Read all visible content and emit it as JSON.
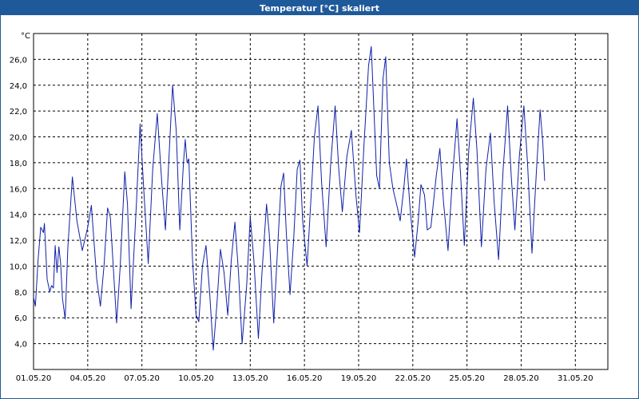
{
  "window": {
    "title": "Temperatur [°C] skaliert"
  },
  "chart_data": {
    "type": "line",
    "title": "Temperatur [°C] skaliert",
    "ylabel": "°C",
    "xlabel": "",
    "ylim": [
      2.0,
      28.0
    ],
    "xlim": [
      0,
      31.8
    ],
    "grid": true,
    "line_color": "#1020a8",
    "y_ticks": [
      {
        "value": 4,
        "label": "4,0"
      },
      {
        "value": 6,
        "label": "6,0"
      },
      {
        "value": 8,
        "label": "8,0"
      },
      {
        "value": 10,
        "label": "10,0"
      },
      {
        "value": 12,
        "label": "12,0"
      },
      {
        "value": 14,
        "label": "14,0"
      },
      {
        "value": 16,
        "label": "16,0"
      },
      {
        "value": 18,
        "label": "18,0"
      },
      {
        "value": 20,
        "label": "20,0"
      },
      {
        "value": 22,
        "label": "22,0"
      },
      {
        "value": 24,
        "label": "24,0"
      },
      {
        "value": 26,
        "label": "26,0"
      }
    ],
    "x_ticks": [
      {
        "value": 0,
        "label": "01.05.20"
      },
      {
        "value": 3,
        "label": "04.05.20"
      },
      {
        "value": 6,
        "label": "07.05.20"
      },
      {
        "value": 9,
        "label": "10.05.20"
      },
      {
        "value": 12,
        "label": "13.05.20"
      },
      {
        "value": 15,
        "label": "16.05.20"
      },
      {
        "value": 18,
        "label": "19.05.20"
      },
      {
        "value": 21,
        "label": "22.05.20"
      },
      {
        "value": 24,
        "label": "25.05.20"
      },
      {
        "value": 27,
        "label": "28.05.20"
      },
      {
        "value": 30,
        "label": "31.05.20"
      }
    ],
    "series": [
      {
        "points": [
          [
            0.0,
            7.6
          ],
          [
            0.1,
            6.9
          ],
          [
            0.25,
            10.5
          ],
          [
            0.4,
            13.0
          ],
          [
            0.55,
            12.6
          ],
          [
            0.6,
            13.3
          ],
          [
            0.75,
            9.0
          ],
          [
            0.9,
            8.0
          ],
          [
            1.0,
            8.5
          ],
          [
            1.1,
            8.3
          ],
          [
            1.2,
            11.6
          ],
          [
            1.3,
            9.5
          ],
          [
            1.4,
            11.5
          ],
          [
            1.5,
            10.2
          ],
          [
            1.6,
            7.5
          ],
          [
            1.75,
            5.9
          ],
          [
            1.9,
            11.5
          ],
          [
            2.15,
            16.9
          ],
          [
            2.4,
            13.5
          ],
          [
            2.7,
            11.2
          ],
          [
            3.0,
            13.0
          ],
          [
            3.2,
            14.7
          ],
          [
            3.5,
            9.0
          ],
          [
            3.7,
            6.9
          ],
          [
            3.9,
            10.0
          ],
          [
            4.1,
            14.5
          ],
          [
            4.25,
            13.8
          ],
          [
            4.6,
            5.6
          ],
          [
            4.8,
            10.0
          ],
          [
            5.05,
            17.3
          ],
          [
            5.2,
            14.8
          ],
          [
            5.4,
            6.7
          ],
          [
            5.7,
            15.0
          ],
          [
            5.9,
            21.0
          ],
          [
            6.1,
            16.0
          ],
          [
            6.35,
            10.2
          ],
          [
            6.6,
            17.5
          ],
          [
            6.85,
            21.8
          ],
          [
            7.1,
            16.5
          ],
          [
            7.3,
            12.8
          ],
          [
            7.5,
            18.5
          ],
          [
            7.7,
            24.0
          ],
          [
            7.9,
            20.5
          ],
          [
            8.1,
            12.8
          ],
          [
            8.3,
            18.0
          ],
          [
            8.4,
            19.8
          ],
          [
            8.5,
            18.0
          ],
          [
            8.6,
            18.3
          ],
          [
            8.8,
            10.5
          ],
          [
            9.0,
            6.2
          ],
          [
            9.15,
            5.7
          ],
          [
            9.35,
            10.0
          ],
          [
            9.55,
            11.6
          ],
          [
            9.75,
            8.0
          ],
          [
            9.95,
            3.5
          ],
          [
            10.15,
            7.0
          ],
          [
            10.35,
            11.3
          ],
          [
            10.55,
            9.5
          ],
          [
            10.75,
            6.2
          ],
          [
            10.95,
            10.5
          ],
          [
            11.15,
            13.4
          ],
          [
            11.35,
            9.5
          ],
          [
            11.55,
            4.0
          ],
          [
            11.8,
            8.5
          ],
          [
            12.0,
            13.8
          ],
          [
            12.2,
            10.5
          ],
          [
            12.45,
            4.4
          ],
          [
            12.65,
            9.5
          ],
          [
            12.9,
            14.8
          ],
          [
            13.05,
            12.5
          ],
          [
            13.3,
            5.6
          ],
          [
            13.5,
            11.0
          ],
          [
            13.7,
            16.2
          ],
          [
            13.85,
            17.2
          ],
          [
            14.0,
            12.5
          ],
          [
            14.2,
            7.8
          ],
          [
            14.4,
            12.0
          ],
          [
            14.6,
            17.5
          ],
          [
            14.75,
            18.2
          ],
          [
            14.9,
            13.5
          ],
          [
            15.15,
            10.0
          ],
          [
            15.35,
            15.0
          ],
          [
            15.55,
            20.0
          ],
          [
            15.75,
            22.4
          ],
          [
            15.95,
            16.5
          ],
          [
            16.2,
            11.5
          ],
          [
            16.45,
            17.8
          ],
          [
            16.7,
            22.4
          ],
          [
            16.9,
            17.5
          ],
          [
            17.1,
            14.2
          ],
          [
            17.35,
            18.5
          ],
          [
            17.6,
            20.5
          ],
          [
            17.85,
            15.5
          ],
          [
            18.05,
            12.6
          ],
          [
            18.3,
            19.5
          ],
          [
            18.55,
            25.5
          ],
          [
            18.7,
            27.0
          ],
          [
            18.85,
            22.0
          ],
          [
            19.0,
            17.0
          ],
          [
            19.15,
            16.0
          ],
          [
            19.35,
            24.5
          ],
          [
            19.5,
            26.2
          ],
          [
            19.7,
            18.0
          ],
          [
            19.9,
            16.0
          ],
          [
            20.15,
            14.5
          ],
          [
            20.3,
            13.5
          ],
          [
            20.5,
            16.0
          ],
          [
            20.65,
            18.3
          ],
          [
            20.85,
            14.5
          ],
          [
            21.1,
            10.7
          ],
          [
            21.3,
            13.5
          ],
          [
            21.45,
            16.3
          ],
          [
            21.65,
            15.5
          ],
          [
            21.8,
            12.8
          ],
          [
            22.0,
            13.0
          ],
          [
            22.3,
            17.0
          ],
          [
            22.5,
            19.1
          ],
          [
            22.7,
            15.0
          ],
          [
            22.95,
            11.2
          ],
          [
            23.2,
            17.0
          ],
          [
            23.45,
            21.4
          ],
          [
            23.65,
            17.0
          ],
          [
            23.85,
            11.6
          ],
          [
            24.1,
            19.0
          ],
          [
            24.35,
            23.0
          ],
          [
            24.55,
            19.0
          ],
          [
            24.8,
            11.5
          ],
          [
            25.05,
            17.5
          ],
          [
            25.3,
            20.3
          ],
          [
            25.5,
            15.0
          ],
          [
            25.75,
            10.5
          ],
          [
            26.0,
            17.5
          ],
          [
            26.25,
            22.4
          ],
          [
            26.45,
            17.0
          ],
          [
            26.65,
            12.8
          ],
          [
            26.9,
            18.5
          ],
          [
            27.15,
            22.4
          ],
          [
            27.35,
            18.0
          ],
          [
            27.6,
            11.0
          ],
          [
            27.85,
            17.5
          ],
          [
            28.05,
            22.1
          ],
          [
            28.2,
            19.5
          ],
          [
            28.3,
            16.6
          ]
        ]
      }
    ]
  }
}
